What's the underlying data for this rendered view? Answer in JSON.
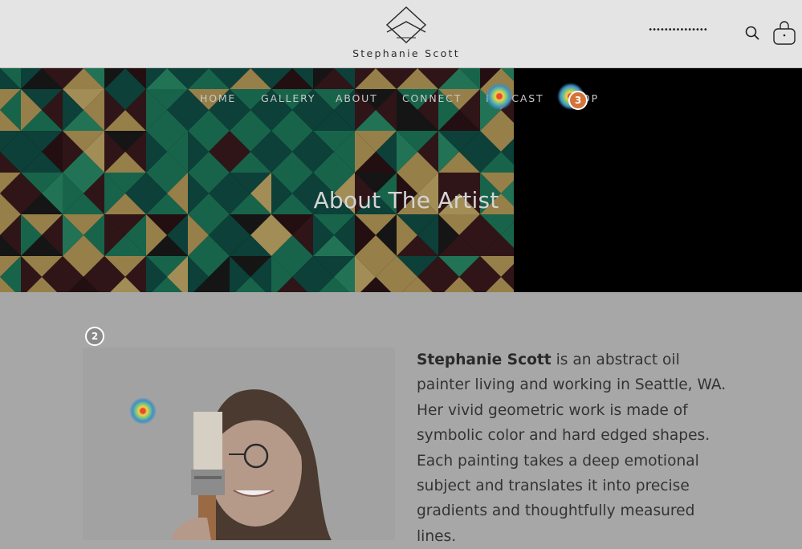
{
  "header": {
    "logo_text": "Stephanie  Scott",
    "account_link": "•••••••••••••••",
    "search_icon": "search-icon",
    "cart_icon": "shopping-bag-icon"
  },
  "nav": {
    "items": [
      {
        "label": "HOME"
      },
      {
        "label": "GALLERY"
      },
      {
        "label": "ABOUT"
      },
      {
        "label": "CONNECT"
      },
      {
        "label": "PODCAST"
      },
      {
        "label": "SHOP"
      }
    ]
  },
  "hero": {
    "title": "About The Artist"
  },
  "markers": {
    "step2": "2",
    "step3": "3"
  },
  "bio": {
    "name": "Stephanie Scott",
    "text": " is an abstract oil painter living and working in Seattle, WA. Her vivid geometric work is made of symbolic color and hard edged shapes. Each painting takes a deep emotional subject and translates it into precise gradients and thoughtfully measured lines."
  },
  "colors": {
    "header_bg": "#e4e4e4",
    "page_bg": "#a7a7a7",
    "art_green": "#1e7a5c",
    "art_gold": "#b79b59",
    "art_maroon": "#3a1a1e",
    "marker_orange": "#d4743a"
  }
}
